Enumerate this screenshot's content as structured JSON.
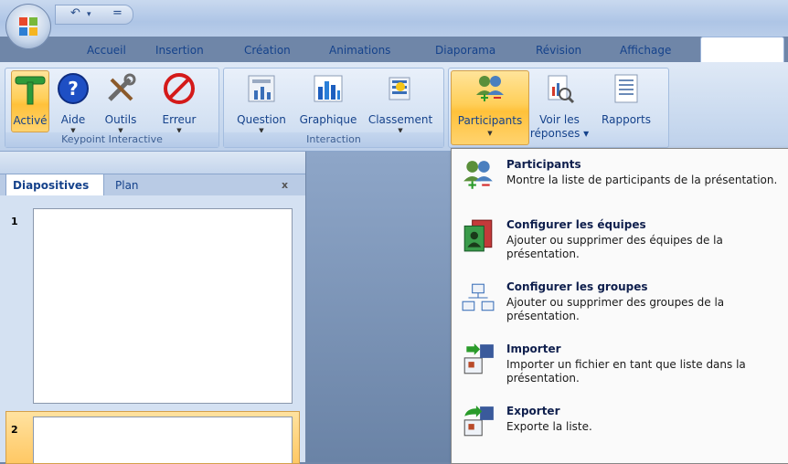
{
  "quick_access": {
    "undo": "↶",
    "dropdown": "▾",
    "customize": "="
  },
  "tabs": [
    "Accueil",
    "Insertion",
    "Création",
    "Animations",
    "Diaporama",
    "Révision",
    "Affichage"
  ],
  "ribbon": {
    "groups": [
      {
        "label": "Keypoint Interactive",
        "buttons": [
          {
            "label": "Activé",
            "dropdown": ""
          },
          {
            "label": "Aide",
            "dropdown": "▼"
          },
          {
            "label": "Outils",
            "dropdown": "▼"
          },
          {
            "label": "Erreur",
            "dropdown": "▼"
          }
        ]
      },
      {
        "label": "Interaction",
        "buttons": [
          {
            "label": "Question",
            "dropdown": "▼"
          },
          {
            "label": "Graphique",
            "dropdown": ""
          },
          {
            "label": "Classement",
            "dropdown": "▼"
          }
        ]
      },
      {
        "label": "",
        "buttons": [
          {
            "label": "Participants",
            "dropdown": "▼"
          },
          {
            "label": "Voir les",
            "label2": "réponses ▾"
          },
          {
            "label": "Rapports",
            "dropdown": ""
          }
        ]
      }
    ]
  },
  "pane": {
    "tabs": [
      "Diapositives",
      "Plan"
    ],
    "close": "x",
    "thumbnails": [
      "1",
      "2"
    ]
  },
  "menu": {
    "items": [
      {
        "title": "Participants",
        "desc": "Montre la liste de participants de la présentation."
      },
      {
        "title": "Configurer les équipes",
        "desc": "Ajouter ou supprimer des équipes de la présentation."
      },
      {
        "title": "Configurer les groupes",
        "desc": "Ajouter ou supprimer des groupes de la présentation."
      },
      {
        "title": "Importer",
        "desc": "Importer un fichier en tant que liste dans la présentation."
      },
      {
        "title": "Exporter",
        "desc": "Exporte la liste."
      }
    ]
  },
  "colors": {
    "accent": "#15428b",
    "highlight": "#ffcf59",
    "ribbon": "#d2e0f2"
  }
}
